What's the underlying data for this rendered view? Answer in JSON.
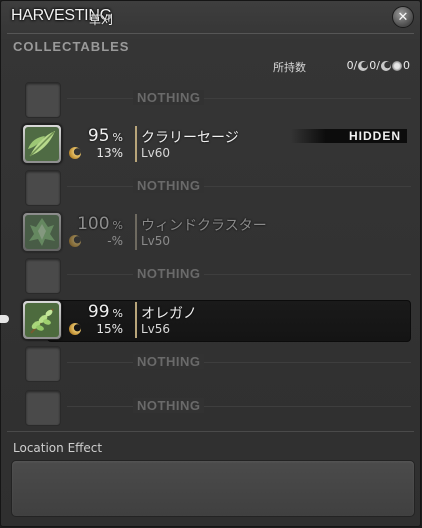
{
  "window": {
    "title": "HARVESTING",
    "title_sub": "草刈",
    "close_icon": "close-icon"
  },
  "section_label": "COLLECTABLES",
  "inventory": {
    "label": "所持数",
    "count_a": "0/",
    "count_b": "0/",
    "count_c": "0"
  },
  "slots": [
    {
      "empty": true,
      "label": "NOTHING"
    },
    {
      "empty": false,
      "chance": "95",
      "unit": "%",
      "hq_chance": "13%",
      "name": "クラリーセージ",
      "level": "Lv60",
      "tag": "HIDDEN",
      "icon": "sage-leaf-icon"
    },
    {
      "empty": true,
      "label": "NOTHING"
    },
    {
      "empty": false,
      "chance": "100",
      "unit": "%",
      "hq_chance": "-%",
      "name": "ウィンドクラスター",
      "level": "Lv50",
      "icon": "wind-cluster-icon"
    },
    {
      "empty": true,
      "label": "NOTHING"
    },
    {
      "empty": false,
      "chance": "99",
      "unit": "%",
      "hq_chance": "15%",
      "name": "オレガノ",
      "level": "Lv56",
      "icon": "oregano-sprig-icon"
    },
    {
      "empty": true,
      "label": "NOTHING"
    },
    {
      "empty": true,
      "label": "NOTHING"
    }
  ],
  "location_effect": {
    "label": "Location Effect",
    "value": ""
  },
  "colors": {
    "background": "#353535",
    "accent_bar": "#b8a57a",
    "collectable_icon": "#e7c26a"
  }
}
